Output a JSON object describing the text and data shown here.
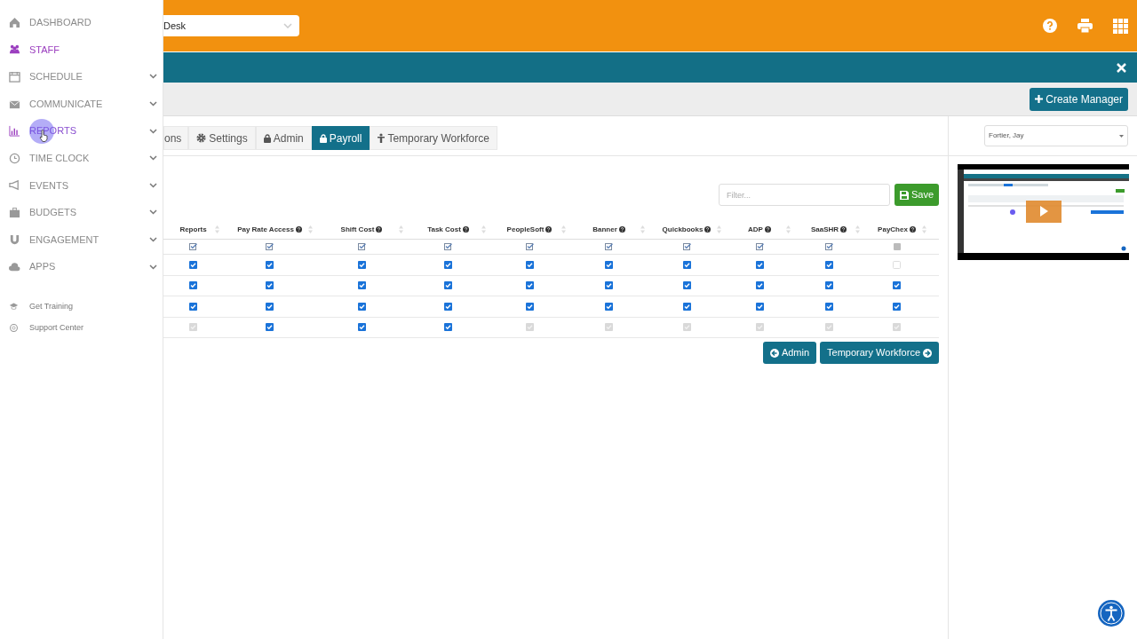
{
  "sidebar": {
    "items": [
      {
        "label": "DASHBOARD",
        "selected": false,
        "hovered": false,
        "expandable": false
      },
      {
        "label": "STAFF",
        "selected": true,
        "hovered": false,
        "expandable": false
      },
      {
        "label": "SCHEDULE",
        "selected": false,
        "hovered": false,
        "expandable": true
      },
      {
        "label": "COMMUNICATE",
        "selected": false,
        "hovered": false,
        "expandable": true
      },
      {
        "label": "REPORTS",
        "selected": false,
        "hovered": true,
        "expandable": true
      },
      {
        "label": "TIME CLOCK",
        "selected": false,
        "hovered": false,
        "expandable": true
      },
      {
        "label": "EVENTS",
        "selected": false,
        "hovered": false,
        "expandable": true
      },
      {
        "label": "BUDGETS",
        "selected": false,
        "hovered": false,
        "expandable": true
      },
      {
        "label": "ENGAGEMENT",
        "selected": false,
        "hovered": false,
        "expandable": true
      },
      {
        "label": "APPS",
        "selected": false,
        "hovered": false,
        "expandable": true
      }
    ],
    "links": [
      "Get Training",
      "Support Center"
    ]
  },
  "header": {
    "location_select": "Desk"
  },
  "toolbar": {
    "create_button": "Create Manager"
  },
  "tabs": [
    {
      "label": "ons",
      "selected": false
    },
    {
      "label": "Settings",
      "selected": false
    },
    {
      "label": "Admin",
      "selected": false
    },
    {
      "label": "Payroll",
      "selected": true
    },
    {
      "label": "Temporary Workforce",
      "selected": false
    }
  ],
  "filter": {
    "placeholder": "Filter..."
  },
  "save_button": "Save",
  "table": {
    "columns": [
      {
        "label": "Reports",
        "help": false
      },
      {
        "label": "Pay Rate Access",
        "help": true
      },
      {
        "label": "Shift Cost",
        "help": true
      },
      {
        "label": "Task Cost",
        "help": true
      },
      {
        "label": "PeopleSoft",
        "help": true
      },
      {
        "label": "Banner",
        "help": true
      },
      {
        "label": "Quickbooks",
        "help": true
      },
      {
        "label": "ADP",
        "help": true
      },
      {
        "label": "SaaSHR",
        "help": true
      },
      {
        "label": "PayChex",
        "help": true
      }
    ],
    "select_all": [
      true,
      true,
      true,
      true,
      true,
      true,
      true,
      true,
      true,
      false
    ],
    "rows": [
      {
        "cells": [
          {
            "checked": true,
            "disabled": false
          },
          {
            "checked": true,
            "disabled": false
          },
          {
            "checked": true,
            "disabled": false
          },
          {
            "checked": true,
            "disabled": false
          },
          {
            "checked": true,
            "disabled": false
          },
          {
            "checked": true,
            "disabled": false
          },
          {
            "checked": true,
            "disabled": false
          },
          {
            "checked": true,
            "disabled": false
          },
          {
            "checked": true,
            "disabled": false
          },
          {
            "checked": false,
            "disabled": false
          }
        ]
      },
      {
        "cells": [
          {
            "checked": true,
            "disabled": false
          },
          {
            "checked": true,
            "disabled": false
          },
          {
            "checked": true,
            "disabled": false
          },
          {
            "checked": true,
            "disabled": false
          },
          {
            "checked": true,
            "disabled": false
          },
          {
            "checked": true,
            "disabled": false
          },
          {
            "checked": true,
            "disabled": false
          },
          {
            "checked": true,
            "disabled": false
          },
          {
            "checked": true,
            "disabled": false
          },
          {
            "checked": true,
            "disabled": false
          }
        ]
      },
      {
        "cells": [
          {
            "checked": true,
            "disabled": false
          },
          {
            "checked": true,
            "disabled": false
          },
          {
            "checked": true,
            "disabled": false
          },
          {
            "checked": true,
            "disabled": false
          },
          {
            "checked": true,
            "disabled": false
          },
          {
            "checked": true,
            "disabled": false
          },
          {
            "checked": true,
            "disabled": false
          },
          {
            "checked": true,
            "disabled": false
          },
          {
            "checked": true,
            "disabled": false
          },
          {
            "checked": true,
            "disabled": false
          }
        ]
      },
      {
        "cells": [
          {
            "checked": true,
            "disabled": true
          },
          {
            "checked": true,
            "disabled": false
          },
          {
            "checked": true,
            "disabled": false
          },
          {
            "checked": true,
            "disabled": false
          },
          {
            "checked": true,
            "disabled": true
          },
          {
            "checked": true,
            "disabled": true
          },
          {
            "checked": true,
            "disabled": true
          },
          {
            "checked": true,
            "disabled": true
          },
          {
            "checked": true,
            "disabled": true
          },
          {
            "checked": true,
            "disabled": true
          }
        ]
      }
    ]
  },
  "nav_buttons": [
    "Admin",
    "Temporary Workforce"
  ],
  "employee_select": "Fortier, Jay"
}
